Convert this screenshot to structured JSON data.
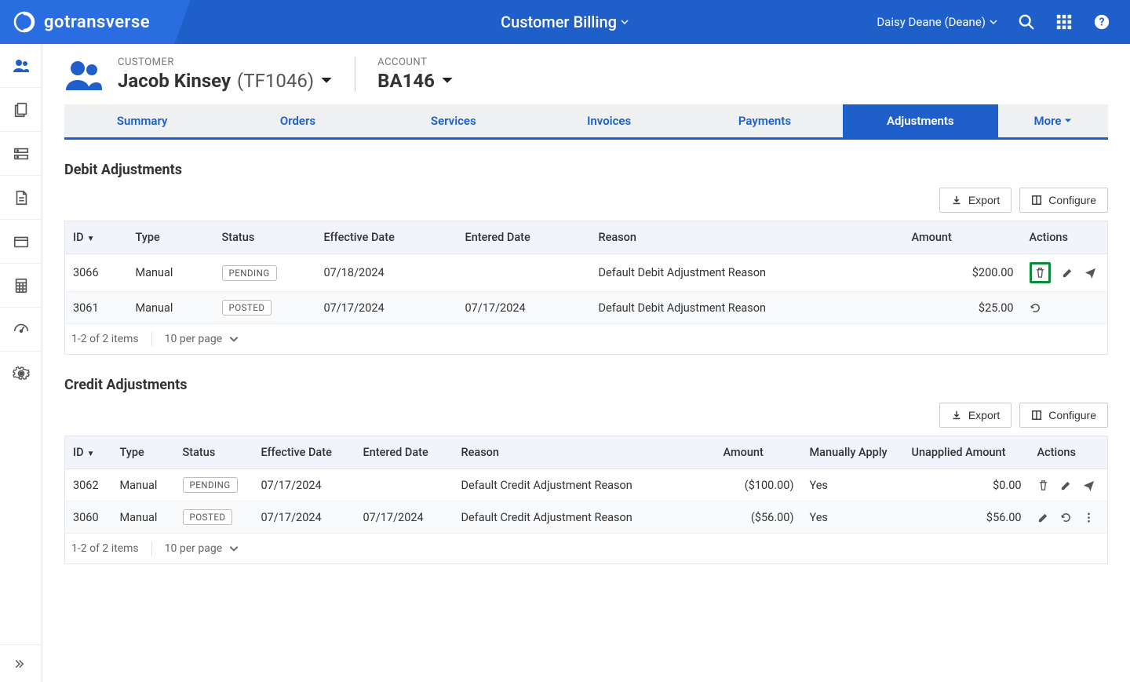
{
  "brand": "gotransverse",
  "page_title": "Customer Billing",
  "user_display": "Daisy Deane (Deane)",
  "header": {
    "customer_label": "CUSTOMER",
    "customer_name": "Jacob Kinsey",
    "customer_code": "(TF1046)",
    "account_label": "ACCOUNT",
    "account_name": "BA146"
  },
  "tabs": {
    "summary": "Summary",
    "orders": "Orders",
    "services": "Services",
    "invoices": "Invoices",
    "payments": "Payments",
    "adjustments": "Adjustments",
    "more": "More"
  },
  "buttons": {
    "export": "Export",
    "configure": "Configure"
  },
  "sections": {
    "debit_title": "Debit Adjustments",
    "credit_title": "Credit Adjustments"
  },
  "columns": {
    "id": "ID",
    "type": "Type",
    "status": "Status",
    "effective": "Effective Date",
    "entered": "Entered Date",
    "reason": "Reason",
    "amount": "Amount",
    "manually_apply": "Manually Apply",
    "unapplied": "Unapplied Amount",
    "actions": "Actions"
  },
  "debit_rows": [
    {
      "id": "3066",
      "type": "Manual",
      "status": "PENDING",
      "effective": "07/18/2024",
      "entered": "",
      "reason": "Default Debit Adjustment Reason",
      "amount": "$200.00"
    },
    {
      "id": "3061",
      "type": "Manual",
      "status": "POSTED",
      "effective": "07/17/2024",
      "entered": "07/17/2024",
      "reason": "Default Debit Adjustment Reason",
      "amount": "$25.00"
    }
  ],
  "credit_rows": [
    {
      "id": "3062",
      "type": "Manual",
      "status": "PENDING",
      "effective": "07/17/2024",
      "entered": "",
      "reason": "Default Credit Adjustment Reason",
      "amount": "($100.00)",
      "manually": "Yes",
      "unapplied": "$0.00"
    },
    {
      "id": "3060",
      "type": "Manual",
      "status": "POSTED",
      "effective": "07/17/2024",
      "entered": "07/17/2024",
      "reason": "Default Credit Adjustment Reason",
      "amount": "($56.00)",
      "manually": "Yes",
      "unapplied": "$56.00"
    }
  ],
  "footer": {
    "debit_count": "1-2 of 2 items",
    "credit_count": "1-2 of 2 items",
    "per_page": "10 per page"
  }
}
